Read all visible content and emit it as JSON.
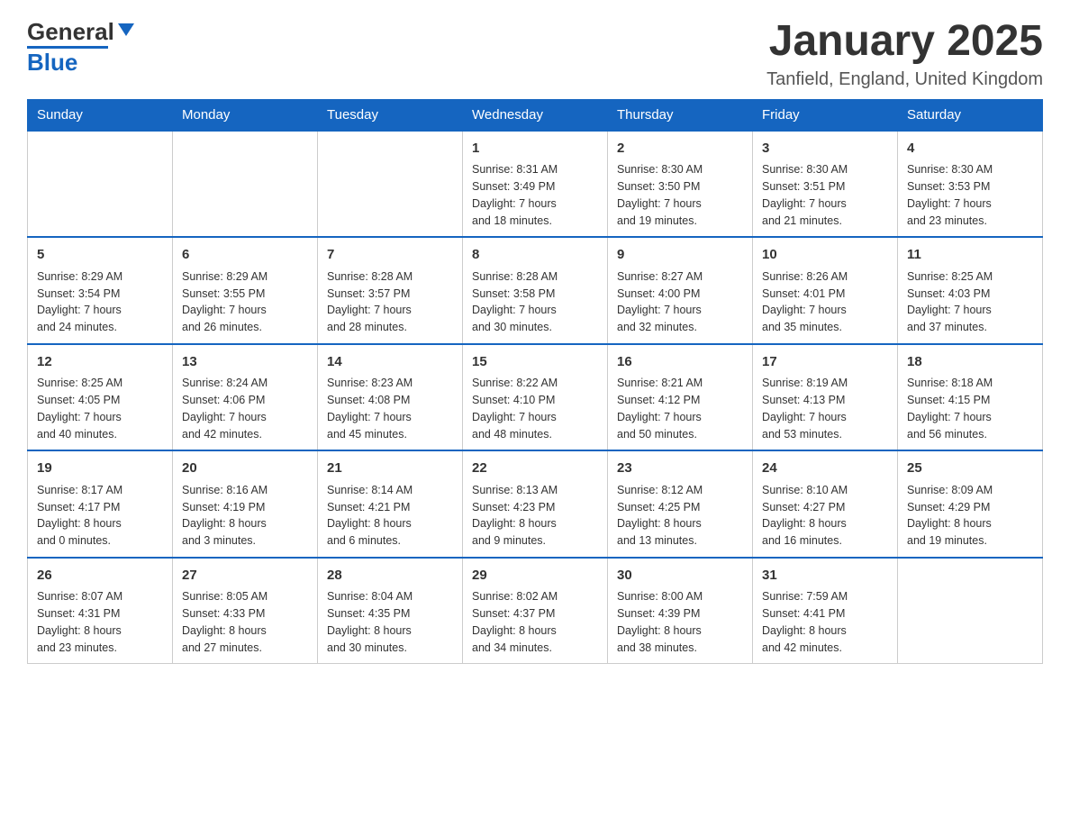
{
  "header": {
    "title": "January 2025",
    "subtitle": "Tanfield, England, United Kingdom",
    "logo_general": "General",
    "logo_blue": "Blue"
  },
  "columns": [
    "Sunday",
    "Monday",
    "Tuesday",
    "Wednesday",
    "Thursday",
    "Friday",
    "Saturday"
  ],
  "weeks": [
    [
      {
        "day": "",
        "info": ""
      },
      {
        "day": "",
        "info": ""
      },
      {
        "day": "",
        "info": ""
      },
      {
        "day": "1",
        "info": "Sunrise: 8:31 AM\nSunset: 3:49 PM\nDaylight: 7 hours\nand 18 minutes."
      },
      {
        "day": "2",
        "info": "Sunrise: 8:30 AM\nSunset: 3:50 PM\nDaylight: 7 hours\nand 19 minutes."
      },
      {
        "day": "3",
        "info": "Sunrise: 8:30 AM\nSunset: 3:51 PM\nDaylight: 7 hours\nand 21 minutes."
      },
      {
        "day": "4",
        "info": "Sunrise: 8:30 AM\nSunset: 3:53 PM\nDaylight: 7 hours\nand 23 minutes."
      }
    ],
    [
      {
        "day": "5",
        "info": "Sunrise: 8:29 AM\nSunset: 3:54 PM\nDaylight: 7 hours\nand 24 minutes."
      },
      {
        "day": "6",
        "info": "Sunrise: 8:29 AM\nSunset: 3:55 PM\nDaylight: 7 hours\nand 26 minutes."
      },
      {
        "day": "7",
        "info": "Sunrise: 8:28 AM\nSunset: 3:57 PM\nDaylight: 7 hours\nand 28 minutes."
      },
      {
        "day": "8",
        "info": "Sunrise: 8:28 AM\nSunset: 3:58 PM\nDaylight: 7 hours\nand 30 minutes."
      },
      {
        "day": "9",
        "info": "Sunrise: 8:27 AM\nSunset: 4:00 PM\nDaylight: 7 hours\nand 32 minutes."
      },
      {
        "day": "10",
        "info": "Sunrise: 8:26 AM\nSunset: 4:01 PM\nDaylight: 7 hours\nand 35 minutes."
      },
      {
        "day": "11",
        "info": "Sunrise: 8:25 AM\nSunset: 4:03 PM\nDaylight: 7 hours\nand 37 minutes."
      }
    ],
    [
      {
        "day": "12",
        "info": "Sunrise: 8:25 AM\nSunset: 4:05 PM\nDaylight: 7 hours\nand 40 minutes."
      },
      {
        "day": "13",
        "info": "Sunrise: 8:24 AM\nSunset: 4:06 PM\nDaylight: 7 hours\nand 42 minutes."
      },
      {
        "day": "14",
        "info": "Sunrise: 8:23 AM\nSunset: 4:08 PM\nDaylight: 7 hours\nand 45 minutes."
      },
      {
        "day": "15",
        "info": "Sunrise: 8:22 AM\nSunset: 4:10 PM\nDaylight: 7 hours\nand 48 minutes."
      },
      {
        "day": "16",
        "info": "Sunrise: 8:21 AM\nSunset: 4:12 PM\nDaylight: 7 hours\nand 50 minutes."
      },
      {
        "day": "17",
        "info": "Sunrise: 8:19 AM\nSunset: 4:13 PM\nDaylight: 7 hours\nand 53 minutes."
      },
      {
        "day": "18",
        "info": "Sunrise: 8:18 AM\nSunset: 4:15 PM\nDaylight: 7 hours\nand 56 minutes."
      }
    ],
    [
      {
        "day": "19",
        "info": "Sunrise: 8:17 AM\nSunset: 4:17 PM\nDaylight: 8 hours\nand 0 minutes."
      },
      {
        "day": "20",
        "info": "Sunrise: 8:16 AM\nSunset: 4:19 PM\nDaylight: 8 hours\nand 3 minutes."
      },
      {
        "day": "21",
        "info": "Sunrise: 8:14 AM\nSunset: 4:21 PM\nDaylight: 8 hours\nand 6 minutes."
      },
      {
        "day": "22",
        "info": "Sunrise: 8:13 AM\nSunset: 4:23 PM\nDaylight: 8 hours\nand 9 minutes."
      },
      {
        "day": "23",
        "info": "Sunrise: 8:12 AM\nSunset: 4:25 PM\nDaylight: 8 hours\nand 13 minutes."
      },
      {
        "day": "24",
        "info": "Sunrise: 8:10 AM\nSunset: 4:27 PM\nDaylight: 8 hours\nand 16 minutes."
      },
      {
        "day": "25",
        "info": "Sunrise: 8:09 AM\nSunset: 4:29 PM\nDaylight: 8 hours\nand 19 minutes."
      }
    ],
    [
      {
        "day": "26",
        "info": "Sunrise: 8:07 AM\nSunset: 4:31 PM\nDaylight: 8 hours\nand 23 minutes."
      },
      {
        "day": "27",
        "info": "Sunrise: 8:05 AM\nSunset: 4:33 PM\nDaylight: 8 hours\nand 27 minutes."
      },
      {
        "day": "28",
        "info": "Sunrise: 8:04 AM\nSunset: 4:35 PM\nDaylight: 8 hours\nand 30 minutes."
      },
      {
        "day": "29",
        "info": "Sunrise: 8:02 AM\nSunset: 4:37 PM\nDaylight: 8 hours\nand 34 minutes."
      },
      {
        "day": "30",
        "info": "Sunrise: 8:00 AM\nSunset: 4:39 PM\nDaylight: 8 hours\nand 38 minutes."
      },
      {
        "day": "31",
        "info": "Sunrise: 7:59 AM\nSunset: 4:41 PM\nDaylight: 8 hours\nand 42 minutes."
      },
      {
        "day": "",
        "info": ""
      }
    ]
  ],
  "accent_color": "#1565c0"
}
